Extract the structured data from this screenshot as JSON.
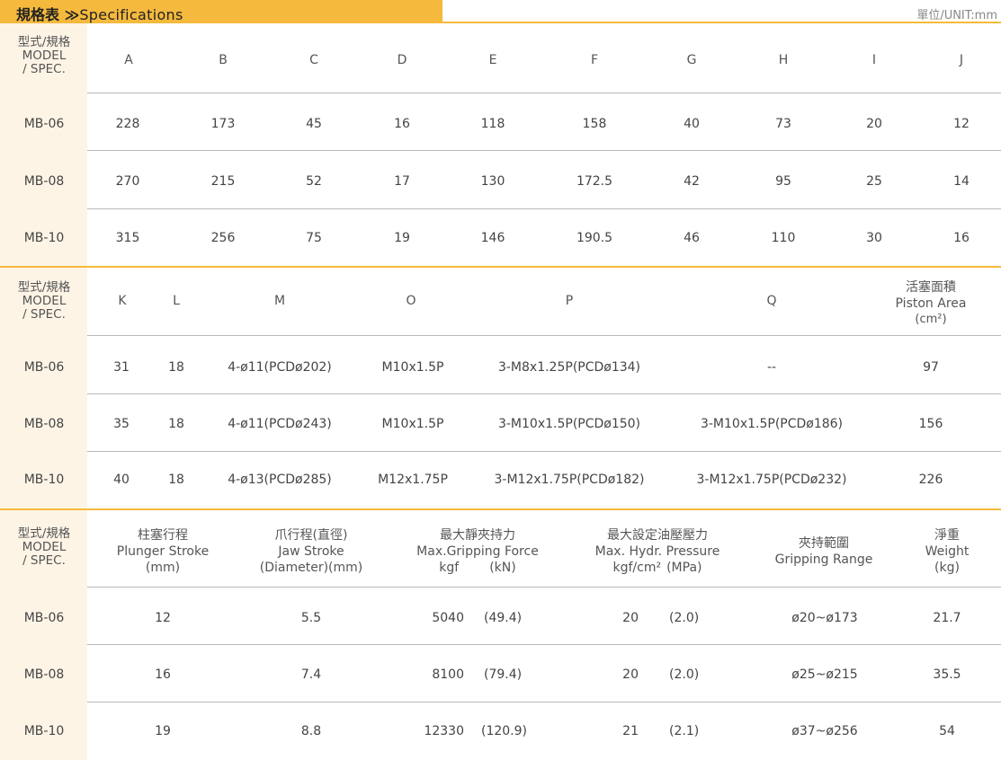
{
  "header": {
    "title_cn": "規格表",
    "title_sep": "≫",
    "title_en": "Specifications",
    "unit": "單位/UNIT:mm"
  },
  "spec_head": {
    "line1": "型式/規格",
    "line2": "MODEL",
    "line3": "/ SPEC."
  },
  "table1": {
    "columns": [
      "A",
      "B",
      "C",
      "D",
      "E",
      "F",
      "G",
      "H",
      "I",
      "J"
    ],
    "rows": [
      {
        "model": "MB-06",
        "values": [
          "228",
          "173",
          "45",
          "16",
          "118",
          "158",
          "40",
          "73",
          "20",
          "12"
        ]
      },
      {
        "model": "MB-08",
        "values": [
          "270",
          "215",
          "52",
          "17",
          "130",
          "172.5",
          "42",
          "95",
          "25",
          "14"
        ]
      },
      {
        "model": "MB-10",
        "values": [
          "315",
          "256",
          "75",
          "19",
          "146",
          "190.5",
          "46",
          "110",
          "30",
          "16"
        ]
      }
    ]
  },
  "table2": {
    "columns": [
      "K",
      "L",
      "M",
      "O",
      "P",
      "Q"
    ],
    "piston_area": {
      "cn": "活塞面積",
      "en": "Piston Area",
      "unit": "(cm²)"
    },
    "rows": [
      {
        "model": "MB-06",
        "values": [
          "31",
          "18",
          "4-ø11(PCDø202)",
          "M10x1.5P",
          "3-M8x1.25P(PCDø134)",
          "--",
          "97"
        ]
      },
      {
        "model": "MB-08",
        "values": [
          "35",
          "18",
          "4-ø11(PCDø243)",
          "M10x1.5P",
          "3-M10x1.5P(PCDø150)",
          "3-M10x1.5P(PCDø186)",
          "156"
        ]
      },
      {
        "model": "MB-10",
        "values": [
          "40",
          "18",
          "4-ø13(PCDø285)",
          "M12x1.75P",
          "3-M12x1.75P(PCDø182)",
          "3-M12x1.75P(PCDø232)",
          "226"
        ]
      }
    ]
  },
  "table3": {
    "columns": [
      {
        "cn": "柱塞行程",
        "en": "Plunger Stroke",
        "unit": "(mm)"
      },
      {
        "cn": "爪行程(直徑)",
        "en": "Jaw Stroke",
        "unit": "(Diameter)(mm)"
      },
      {
        "cn": "最大靜夾持力",
        "en": "Max.Gripping Force",
        "unit_a": "kgf",
        "unit_b": "(kN)"
      },
      {
        "cn": "最大設定油壓壓力",
        "en": "Max. Hydr. Pressure",
        "unit_a": "kgf/cm²",
        "unit_b": "(MPa)"
      },
      {
        "cn": "夾持範圍",
        "en": "Gripping Range"
      },
      {
        "cn": "淨重",
        "en": "Weight",
        "unit": "(kg)"
      }
    ],
    "rows": [
      {
        "model": "MB-06",
        "stroke": "12",
        "jaw": "5.5",
        "force_kgf": "5040",
        "force_kn": "(49.4)",
        "pres_kgf": "20",
        "pres_mpa": "(2.0)",
        "range": "ø20~ø173",
        "weight": "21.7"
      },
      {
        "model": "MB-08",
        "stroke": "16",
        "jaw": "7.4",
        "force_kgf": "8100",
        "force_kn": "(79.4)",
        "pres_kgf": "20",
        "pres_mpa": "(2.0)",
        "range": "ø25~ø215",
        "weight": "35.5"
      },
      {
        "model": "MB-10",
        "stroke": "19",
        "jaw": "8.8",
        "force_kgf": "12330",
        "force_kn": "(120.9)",
        "pres_kgf": "21",
        "pres_mpa": "(2.1)",
        "range": "ø37~ø256",
        "weight": "54"
      }
    ]
  }
}
